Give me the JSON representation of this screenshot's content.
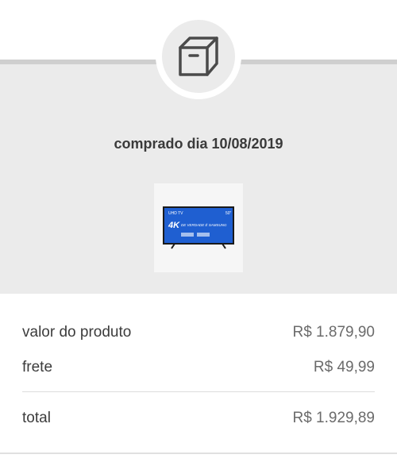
{
  "header": {
    "icon": "box-icon",
    "purchase_date": "comprado dia 10/08/2019"
  },
  "product": {
    "image_caption_small": "UHD TV",
    "image_caption_size": "50\"",
    "image_headline": "4K",
    "image_tagline": "DE VERDADE É SAMSUNG"
  },
  "summary": {
    "product_label": "valor do produto",
    "product_value": "R$ 1.879,90",
    "shipping_label": "frete",
    "shipping_value": "R$ 49,99",
    "total_label": "total",
    "total_value": "R$ 1.929,89"
  },
  "colors": {
    "panel_bg": "#ebebeb",
    "tv_screen": "#1f5fd1"
  }
}
